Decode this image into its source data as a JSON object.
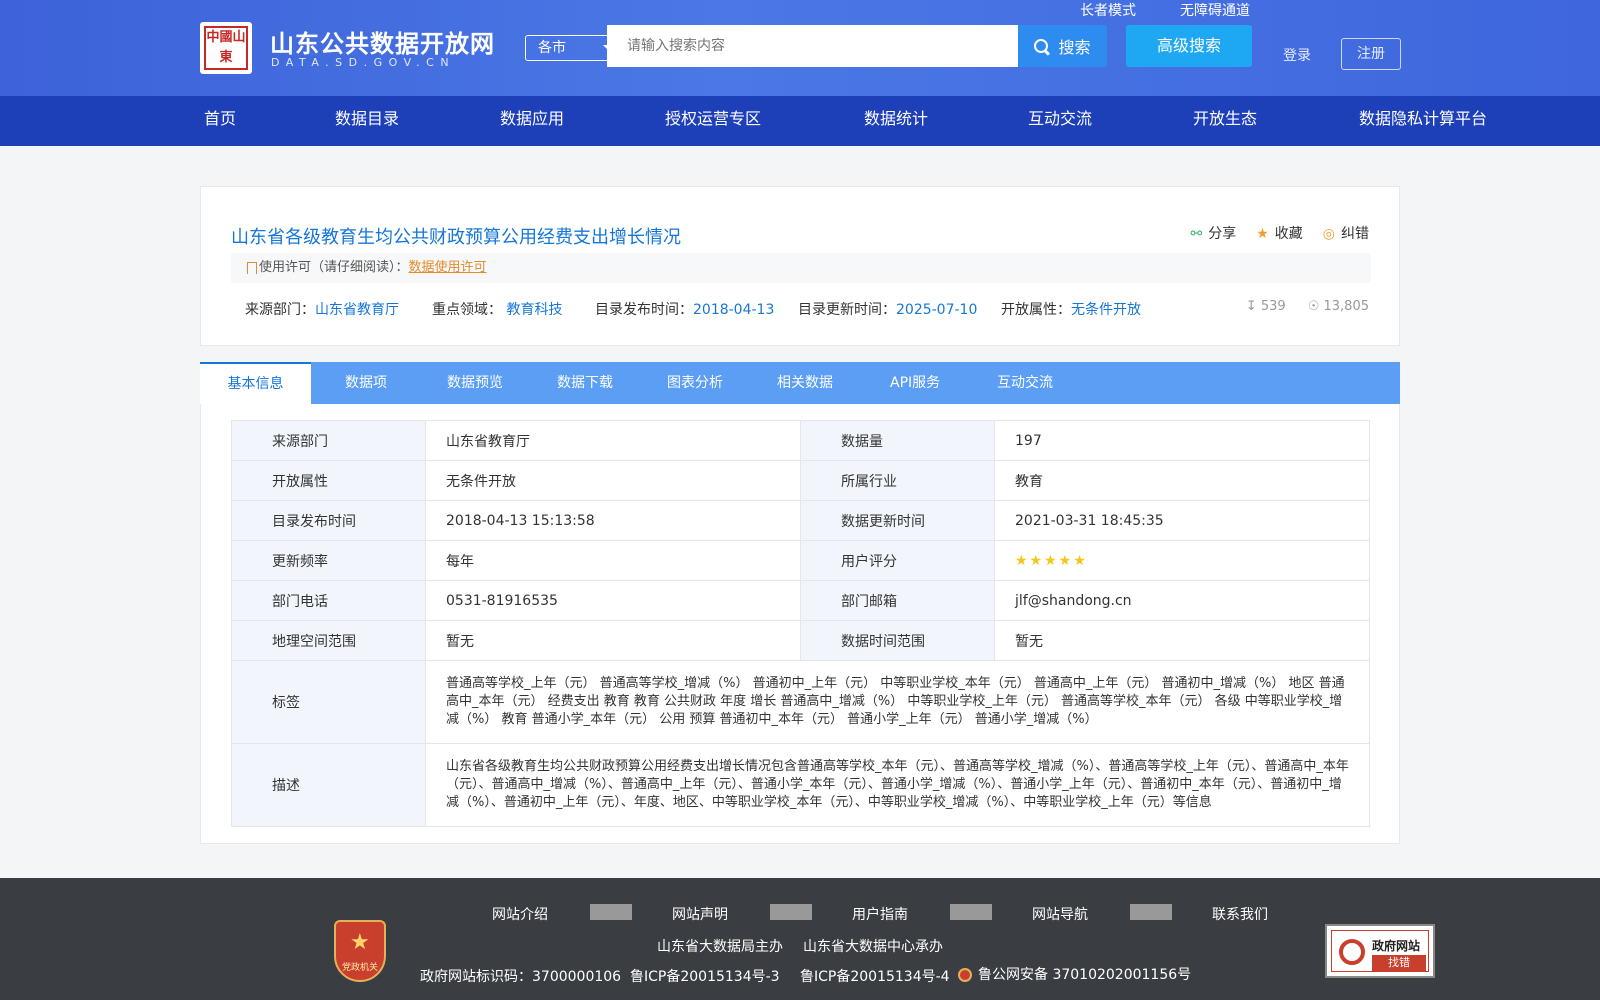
{
  "header": {
    "logo_text": "中國山東",
    "site_name": "山东公共数据开放网",
    "site_domain": "DATA.SD.GOV.CN",
    "city_select": "各市",
    "search_placeholder": "请输入搜索内容",
    "search_label": "搜索",
    "advanced_search": "高级搜索",
    "elder_mode": "长者模式",
    "accessibility": "无障碍通道",
    "login": "登录",
    "register": "注册"
  },
  "nav": [
    "首页",
    "数据目录",
    "数据应用",
    "授权运营专区",
    "数据统计",
    "互动交流",
    "开放生态",
    "数据隐私计算平台"
  ],
  "dataset": {
    "title": "山东省各级教育生均公共财政预算公用经费支出增长情况",
    "actions": {
      "share": "分享",
      "favorite": "收藏",
      "report": "纠错"
    },
    "license_label": "使用许可（请仔细阅读）：",
    "license_link": "数据使用许可",
    "meta": {
      "source_label": "来源部门：",
      "source": "山东省教育厅",
      "field_label": "重点领域：",
      "field": "教育科技",
      "publish_label": "目录发布时间：",
      "publish": "2018-04-13",
      "update_label": "目录更新时间：",
      "update": "2025-07-10",
      "open_label": "开放属性：",
      "open": "无条件开放"
    },
    "downloads": "539",
    "views": "13,805"
  },
  "tabs": [
    "基本信息",
    "数据项",
    "数据预览",
    "数据下载",
    "图表分析",
    "相关数据",
    "API服务",
    "互动交流"
  ],
  "details": {
    "source_k": "来源部门",
    "source_v": "山东省教育厅",
    "volume_k": "数据量",
    "volume_v": "197",
    "open_k": "开放属性",
    "open_v": "无条件开放",
    "industry_k": "所属行业",
    "industry_v": "教育",
    "publish_k": "目录发布时间",
    "publish_v": "2018-04-13 15:13:58",
    "dupdate_k": "数据更新时间",
    "dupdate_v": "2021-03-31 18:45:35",
    "freq_k": "更新频率",
    "freq_v": "每年",
    "rating_k": "用户评分",
    "rating_v": 5,
    "phone_k": "部门电话",
    "phone_v": "0531-81916535",
    "email_k": "部门邮箱",
    "email_v": "jlf@shandong.cn",
    "geo_k": "地理空间范围",
    "geo_v": "暂无",
    "time_k": "数据时间范围",
    "time_v": "暂无",
    "tags_k": "标签",
    "tags_v": "普通高等学校_上年（元） 普通高等学校_增减（%） 普通初中_上年（元） 中等职业学校_本年（元） 普通高中_上年（元） 普通初中_增减（%） 地区 普通高中_本年（元） 经费支出 教育 教育 公共财政 年度 增长 普通高中_增减（%） 中等职业学校_上年（元） 普通高等学校_本年（元） 各级 中等职业学校_增减（%） 教育 普通小学_本年（元） 公用 预算 普通初中_本年（元） 普通小学_上年（元） 普通小学_增减（%）",
    "desc_k": "描述",
    "desc_v": "山东省各级教育生均公共财政预算公用经费支出增长情况包含普通高等学校_本年（元）、普通高等学校_增减（%）、普通高等学校_上年（元）、普通高中_本年（元）、普通高中_增减（%）、普通高中_上年（元）、普通小学_本年（元）、普通小学_增减（%）、普通小学_上年（元）、普通初中_本年（元）、普通初中_增减（%）、普通初中_上年（元）、年度、地区、中等职业学校_本年（元）、中等职业学校_增减（%）、中等职业学校_上年（元）等信息"
  },
  "footer": {
    "badge": "党政机关",
    "links": [
      "网站介绍",
      "网站声明",
      "用户指南",
      "网站导航",
      "联系我们"
    ],
    "sponsor": "山东省大数据局主办",
    "organizer": "山东省大数据中心承办",
    "site_id": "政府网站标识码：3700000106",
    "icp1": "鲁ICP备20015134号-3",
    "icp2": "鲁ICP备20015134号-4",
    "police": "鲁公网安备 37010202001156号",
    "gov_badge_title": "政府网站",
    "gov_badge_action": "找错"
  }
}
